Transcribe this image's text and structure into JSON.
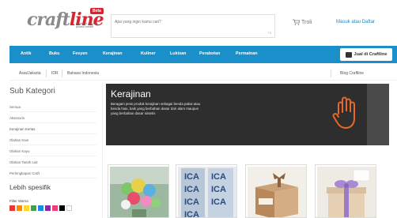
{
  "header": {
    "logo_text_a": "craft",
    "logo_text_b": "line",
    "beta_badge": "Beta",
    "tagline": "panduan jual beli produk kreatif",
    "search_placeholder": "Apa yang ingin kamu cari?",
    "search_count": "73",
    "trolley_label": "Troli",
    "login_label": "Masuk atau Daftar"
  },
  "nav": {
    "items": [
      "Antik",
      "Buku",
      "Fesyen",
      "Kerajinan",
      "Kuliner",
      "Lukisan",
      "Perabotan",
      "Permainan"
    ],
    "sell_button": "Jual di Craftline"
  },
  "subbar": {
    "timezone": "Asia/Jakarta",
    "currency": "IDR",
    "language": "Bahasa Indonesia",
    "blog_link": "Blog Craftline"
  },
  "sidebar": {
    "title": "Sub Kategori",
    "items": [
      "Semua",
      "Aksesoris",
      "Kerajinan Kertas",
      "Olahan Kain",
      "Olahan Kayu",
      "Olahan Tanah Liat",
      "Perlengkapan Craft"
    ],
    "more_title": "Lebih spesifik",
    "filter_label": "Filter Warna",
    "swatch_colors": [
      "#e53935",
      "#fb8c00",
      "#fdd835",
      "#43a047",
      "#1e88e5",
      "#8e24aa",
      "#ec407a",
      "#000000",
      "#ffffff"
    ]
  },
  "banner": {
    "title": "Kerajinan",
    "description": "Beragam jenis produk kerajinan sebagai benda pakai atau benda hias, baik yang berbahan dasar dari alam maupun yang berbahan dasar sintetis",
    "accent_color": "#e8672a"
  },
  "products": [
    {
      "name": "product-bouquet"
    },
    {
      "name": "product-ica-stickers"
    },
    {
      "name": "product-gift-box"
    },
    {
      "name": "product-ribbon-box"
    }
  ]
}
